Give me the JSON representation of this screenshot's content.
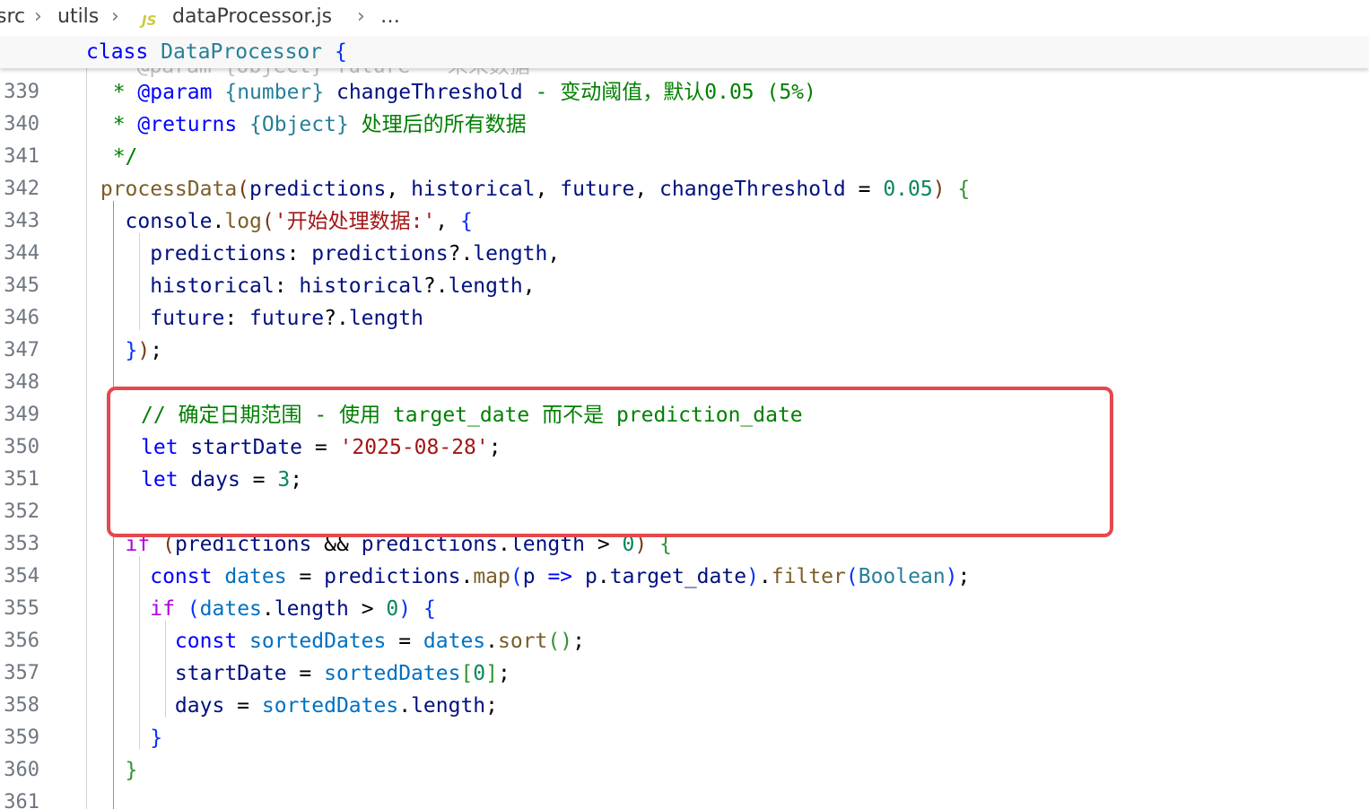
{
  "breadcrumb": {
    "segments": [
      "src",
      "utils"
    ],
    "file_icon": "JS",
    "file": "dataProcessor.js",
    "ellipsis": "…"
  },
  "sticky": {
    "keyword": "class",
    "class_name": "DataProcessor",
    "brace": "{"
  },
  "ghost_line": "* @param {Object} future - 未来数据",
  "colors": {
    "keyword": "#0000ff",
    "control": "#af00db",
    "class": "#267f99",
    "function": "#795e26",
    "variable": "#001080",
    "constant": "#0070c1",
    "string": "#a31515",
    "number": "#098658",
    "comment": "#008000",
    "highlight_border": "#e5484d"
  },
  "lines": [
    {
      "n": "339",
      "tokens": [
        [
          "t-cmt",
          "  * "
        ],
        [
          "t-kw",
          "@param"
        ],
        [
          "t-cmt",
          " "
        ],
        [
          "t-cls",
          "{number}"
        ],
        [
          "t-cmt",
          " "
        ],
        [
          "t-var",
          "changeThreshold"
        ],
        [
          "t-cmt",
          " - 变动阈值，默认0.05 (5%)"
        ]
      ]
    },
    {
      "n": "340",
      "tokens": [
        [
          "t-cmt",
          "  * "
        ],
        [
          "t-kw",
          "@returns"
        ],
        [
          "t-cmt",
          " "
        ],
        [
          "t-cls",
          "{Object}"
        ],
        [
          "t-cmt",
          " 处理后的所有数据"
        ]
      ]
    },
    {
      "n": "341",
      "tokens": [
        [
          "t-cmt",
          "  */"
        ]
      ]
    },
    {
      "n": "342",
      "tokens": [
        [
          "t-fn",
          " processData"
        ],
        [
          "t-br3",
          "("
        ],
        [
          "t-var",
          "predictions"
        ],
        [
          "t-punc",
          ", "
        ],
        [
          "t-var",
          "historical"
        ],
        [
          "t-punc",
          ", "
        ],
        [
          "t-var",
          "future"
        ],
        [
          "t-punc",
          ", "
        ],
        [
          "t-var",
          "changeThreshold"
        ],
        [
          "t-punc",
          " = "
        ],
        [
          "t-num",
          "0.05"
        ],
        [
          "t-br3",
          ")"
        ],
        [
          "t-punc",
          " "
        ],
        [
          "t-br2",
          "{"
        ]
      ]
    },
    {
      "n": "343",
      "tokens": [
        [
          "t-var",
          "   console"
        ],
        [
          "t-punc",
          "."
        ],
        [
          "t-fn",
          "log"
        ],
        [
          "t-br3",
          "("
        ],
        [
          "t-str",
          "'开始处理数据:'"
        ],
        [
          "t-punc",
          ", "
        ],
        [
          "t-br1",
          "{"
        ]
      ]
    },
    {
      "n": "344",
      "tokens": [
        [
          "t-var",
          "     predictions"
        ],
        [
          "t-punc",
          ": "
        ],
        [
          "t-var",
          "predictions"
        ],
        [
          "t-punc",
          "?."
        ],
        [
          "t-var",
          "length"
        ],
        [
          "t-punc",
          ","
        ]
      ]
    },
    {
      "n": "345",
      "tokens": [
        [
          "t-var",
          "     historical"
        ],
        [
          "t-punc",
          ": "
        ],
        [
          "t-var",
          "historical"
        ],
        [
          "t-punc",
          "?."
        ],
        [
          "t-var",
          "length"
        ],
        [
          "t-punc",
          ","
        ]
      ]
    },
    {
      "n": "346",
      "tokens": [
        [
          "t-var",
          "     future"
        ],
        [
          "t-punc",
          ": "
        ],
        [
          "t-var",
          "future"
        ],
        [
          "t-punc",
          "?."
        ],
        [
          "t-var",
          "length"
        ]
      ]
    },
    {
      "n": "347",
      "tokens": [
        [
          "t-br1",
          "   }"
        ],
        [
          "t-br3",
          ")"
        ],
        [
          "t-punc",
          ";"
        ]
      ]
    },
    {
      "n": "348",
      "tokens": []
    },
    {
      "n": "349",
      "tokens": []
    },
    {
      "n": "350",
      "tokens": []
    },
    {
      "n": "351",
      "tokens": []
    },
    {
      "n": "352",
      "tokens": []
    },
    {
      "n": "353",
      "tokens": [
        [
          "t-ctrl",
          "   if"
        ],
        [
          "t-punc",
          " "
        ],
        [
          "t-br3",
          "("
        ],
        [
          "t-var",
          "predictions"
        ],
        [
          "t-punc",
          " && "
        ],
        [
          "t-var",
          "predictions"
        ],
        [
          "t-punc",
          "."
        ],
        [
          "t-var",
          "length"
        ],
        [
          "t-punc",
          " > "
        ],
        [
          "t-num",
          "0"
        ],
        [
          "t-br3",
          ")"
        ],
        [
          "t-punc",
          " "
        ],
        [
          "t-br2",
          "{"
        ]
      ]
    },
    {
      "n": "354",
      "tokens": [
        [
          "t-kw",
          "     const"
        ],
        [
          "t-punc",
          " "
        ],
        [
          "t-const",
          "dates"
        ],
        [
          "t-punc",
          " = "
        ],
        [
          "t-var",
          "predictions"
        ],
        [
          "t-punc",
          "."
        ],
        [
          "t-fn",
          "map"
        ],
        [
          "t-br1",
          "("
        ],
        [
          "t-var",
          "p"
        ],
        [
          "t-punc",
          " "
        ],
        [
          "t-kw",
          "=>"
        ],
        [
          "t-punc",
          " "
        ],
        [
          "t-var",
          "p"
        ],
        [
          "t-punc",
          "."
        ],
        [
          "t-var",
          "target_date"
        ],
        [
          "t-br1",
          ")"
        ],
        [
          "t-punc",
          "."
        ],
        [
          "t-fn",
          "filter"
        ],
        [
          "t-br1",
          "("
        ],
        [
          "t-cls",
          "Boolean"
        ],
        [
          "t-br1",
          ")"
        ],
        [
          "t-punc",
          ";"
        ]
      ]
    },
    {
      "n": "355",
      "tokens": [
        [
          "t-ctrl",
          "     if"
        ],
        [
          "t-punc",
          " "
        ],
        [
          "t-br1",
          "("
        ],
        [
          "t-const",
          "dates"
        ],
        [
          "t-punc",
          "."
        ],
        [
          "t-var",
          "length"
        ],
        [
          "t-punc",
          " > "
        ],
        [
          "t-num",
          "0"
        ],
        [
          "t-br1",
          ")"
        ],
        [
          "t-punc",
          " "
        ],
        [
          "t-br1",
          "{"
        ]
      ]
    },
    {
      "n": "356",
      "tokens": [
        [
          "t-kw",
          "       const"
        ],
        [
          "t-punc",
          " "
        ],
        [
          "t-const",
          "sortedDates"
        ],
        [
          "t-punc",
          " = "
        ],
        [
          "t-const",
          "dates"
        ],
        [
          "t-punc",
          "."
        ],
        [
          "t-fn",
          "sort"
        ],
        [
          "t-br2",
          "()"
        ],
        [
          "t-punc",
          ";"
        ]
      ]
    },
    {
      "n": "357",
      "tokens": [
        [
          "t-var",
          "       startDate"
        ],
        [
          "t-punc",
          " = "
        ],
        [
          "t-const",
          "sortedDates"
        ],
        [
          "t-br2",
          "["
        ],
        [
          "t-num",
          "0"
        ],
        [
          "t-br2",
          "]"
        ],
        [
          "t-punc",
          ";"
        ]
      ]
    },
    {
      "n": "358",
      "tokens": [
        [
          "t-var",
          "       days"
        ],
        [
          "t-punc",
          " = "
        ],
        [
          "t-const",
          "sortedDates"
        ],
        [
          "t-punc",
          "."
        ],
        [
          "t-var",
          "length"
        ],
        [
          "t-punc",
          ";"
        ]
      ]
    },
    {
      "n": "359",
      "tokens": [
        [
          "t-br1",
          "     }"
        ]
      ]
    },
    {
      "n": "360",
      "tokens": [
        [
          "t-br2",
          "   }"
        ]
      ]
    },
    {
      "n": "361",
      "tokens": []
    }
  ],
  "highlighted": [
    [
      [
        "t-cmt",
        "// 确定日期范围 - 使用 target_date 而不是 prediction_date"
      ]
    ],
    [
      [
        "t-kw",
        "let"
      ],
      [
        "t-punc",
        " "
      ],
      [
        "t-var",
        "startDate"
      ],
      [
        "t-punc",
        " = "
      ],
      [
        "t-str",
        "'2025-08-28'"
      ],
      [
        "t-punc",
        ";"
      ]
    ],
    [
      [
        "t-kw",
        "let"
      ],
      [
        "t-punc",
        " "
      ],
      [
        "t-var",
        "days"
      ],
      [
        "t-punc",
        " = "
      ],
      [
        "t-num",
        "3"
      ],
      [
        "t-punc",
        ";"
      ]
    ]
  ]
}
